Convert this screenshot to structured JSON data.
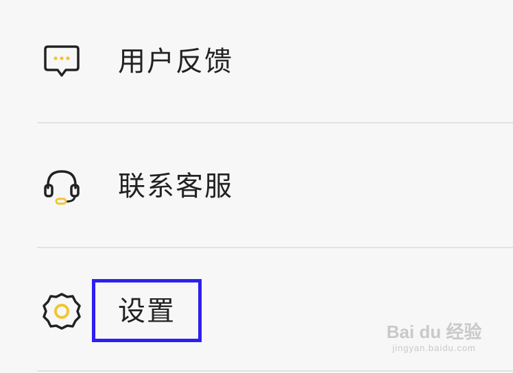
{
  "menu": {
    "items": [
      {
        "label": "用户反馈",
        "icon": "feedback-bubble-icon"
      },
      {
        "label": "联系客服",
        "icon": "headset-icon"
      },
      {
        "label": "设置",
        "icon": "gear-icon"
      }
    ]
  },
  "colors": {
    "accent": "#f2c530",
    "icon_stroke": "#222222",
    "highlight": "#2d1ff0",
    "divider": "#e2e2e2",
    "background": "#f7f7f7"
  },
  "watermark": {
    "brand": "Bai du 经验",
    "url": "jingyan.baidu.com"
  }
}
